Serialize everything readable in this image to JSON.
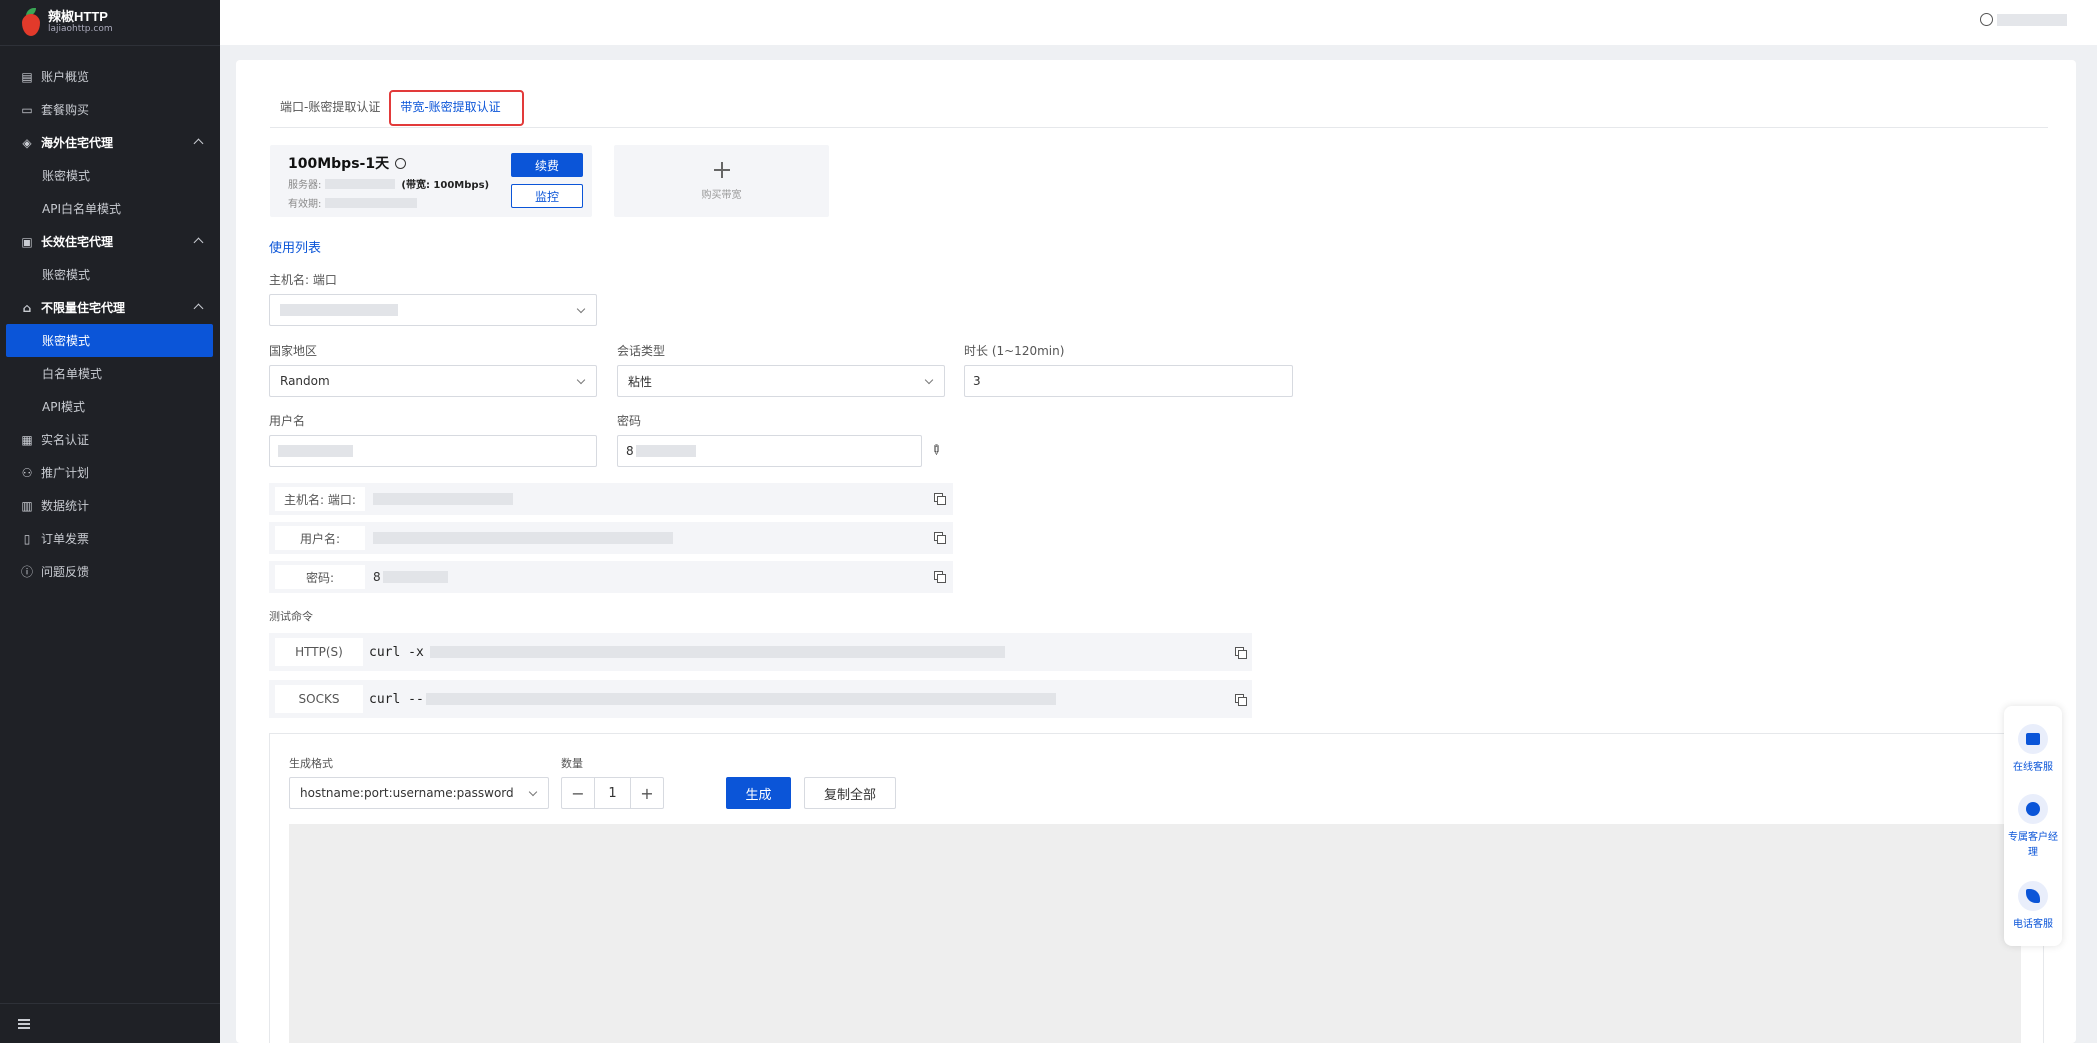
{
  "brand": {
    "title": "辣椒HTTP",
    "subtitle": "lajiaohttp.com"
  },
  "sidebar": {
    "items": [
      {
        "label": "账户概览",
        "icon": "account-overview-icon"
      },
      {
        "label": "套餐购买",
        "icon": "package-icon"
      },
      {
        "label": "海外住宅代理",
        "icon": "residential-proxy-icon"
      },
      {
        "label": "账密模式"
      },
      {
        "label": "API白名单模式"
      },
      {
        "label": "长效住宅代理",
        "icon": "long-term-proxy-icon"
      },
      {
        "label": "账密模式"
      },
      {
        "label": "不限量住宅代理",
        "icon": "unlimited-proxy-icon"
      },
      {
        "label": "账密模式"
      },
      {
        "label": "白名单模式"
      },
      {
        "label": "API模式"
      },
      {
        "label": "实名认证",
        "icon": "id-card-icon"
      },
      {
        "label": "推广计划",
        "icon": "referral-icon"
      },
      {
        "label": "数据统计",
        "icon": "chart-icon"
      },
      {
        "label": "订单发票",
        "icon": "invoice-icon"
      },
      {
        "label": "问题反馈",
        "icon": "feedback-icon"
      }
    ]
  },
  "tabs": [
    {
      "label": "端口-账密提取认证"
    },
    {
      "label": "带宽-账密提取认证"
    }
  ],
  "plan": {
    "name": "100Mbps-1天",
    "server_label": "服务器:",
    "bandwidth": "(带宽: 100Mbps)",
    "expiry_label": "有效期:",
    "renew_label": "续费",
    "monitor_label": "监控"
  },
  "buy_bandwidth_label": "购买带宽",
  "usage_list_label": "使用列表",
  "form": {
    "host_port_label": "主机名: 端口",
    "country_label": "国家地区",
    "country_value": "Random",
    "session_label": "会话类型",
    "session_value": "粘性",
    "duration_label": "时长 (1~120min)",
    "duration_value": "3",
    "username_label": "用户名",
    "password_label": "密码",
    "password_value": "8"
  },
  "info": {
    "host_key": "主机名: 端口:",
    "user_key": "用户名:",
    "pass_key": "密码:",
    "pass_val": "8"
  },
  "test_cmd": {
    "label": "测试命令",
    "http_key": "HTTP(S)",
    "http_val": "curl -x",
    "socks_key": "SOCKS",
    "socks_val": "curl --"
  },
  "generator": {
    "format_label": "生成格式",
    "format_value": "hostname:port:username:password",
    "quantity_label": "数量",
    "quantity_value": "1",
    "minus": "−",
    "plus": "+",
    "generate_label": "生成",
    "copy_all_label": "复制全部"
  },
  "support": [
    {
      "label": "在线客服"
    },
    {
      "label": "专属客户经理"
    },
    {
      "label": "电话客服"
    }
  ],
  "colors": {
    "accent": "#0b55d8",
    "sidebar_bg": "#1f2126",
    "highlight": "#e23a3a"
  }
}
